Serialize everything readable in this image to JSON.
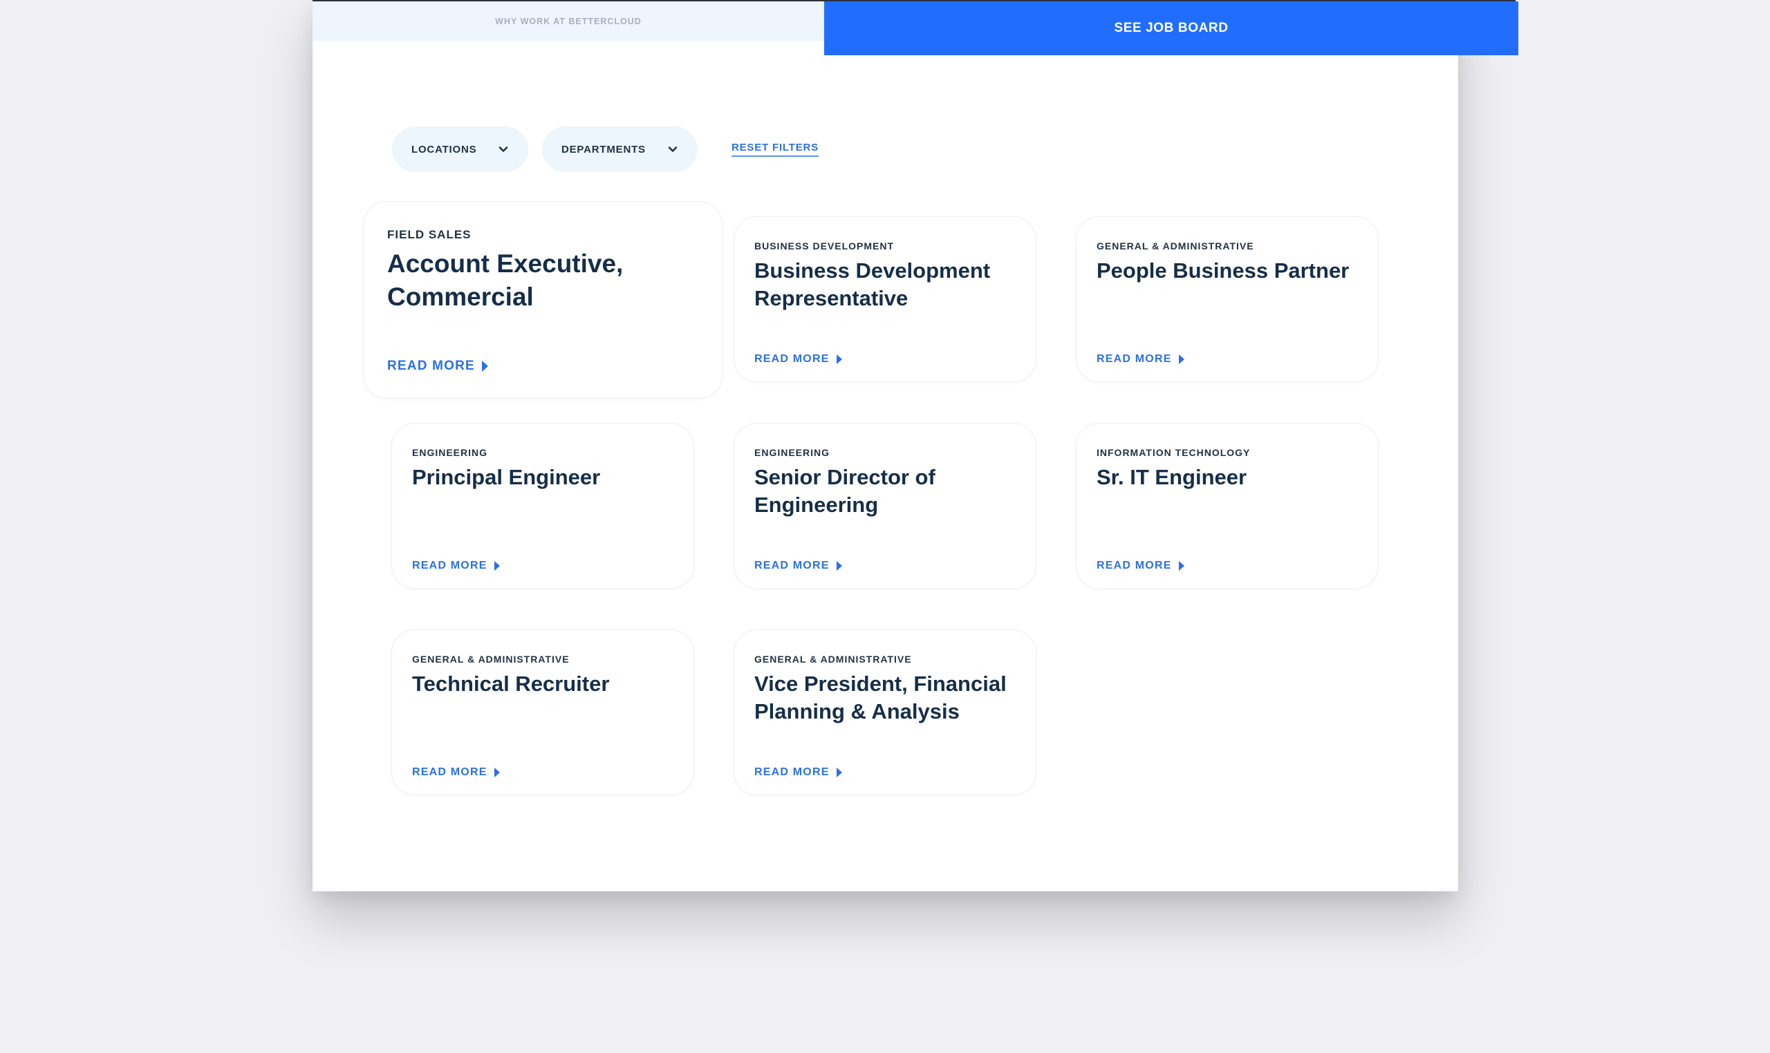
{
  "header": {
    "why_tab_label": "WHY WORK AT BETTERCLOUD",
    "job_board_label": "SEE JOB BOARD"
  },
  "filters": {
    "locations_label": "LOCATIONS",
    "departments_label": "DEPARTMENTS",
    "reset_label": "RESET FILTERS"
  },
  "colors": {
    "accent": "#216efe",
    "title": "#152e49",
    "link": "#2a70e7",
    "pill_bg": "#edf5fd"
  },
  "jobs": [
    {
      "department": "FIELD SALES",
      "title": "Account Executive, Commercial",
      "cta": "READ MORE"
    },
    {
      "department": "BUSINESS DEVELOPMENT",
      "title": "Business Development Representative",
      "cta": "READ MORE"
    },
    {
      "department": "GENERAL & ADMINISTRATIVE",
      "title": "People Business Partner",
      "cta": "READ MORE"
    },
    {
      "department": "ENGINEERING",
      "title": "Principal Engineer",
      "cta": "READ MORE"
    },
    {
      "department": "ENGINEERING",
      "title": "Senior Director of Engineering",
      "cta": "READ MORE"
    },
    {
      "department": "INFORMATION TECHNOLOGY",
      "title": "Sr. IT Engineer",
      "cta": "READ MORE"
    },
    {
      "department": "GENERAL & ADMINISTRATIVE",
      "title": "Technical Recruiter",
      "cta": "READ MORE"
    },
    {
      "department": "GENERAL & ADMINISTRATIVE",
      "title": "Vice President, Financial Planning & Analysis",
      "cta": "READ MORE"
    }
  ]
}
